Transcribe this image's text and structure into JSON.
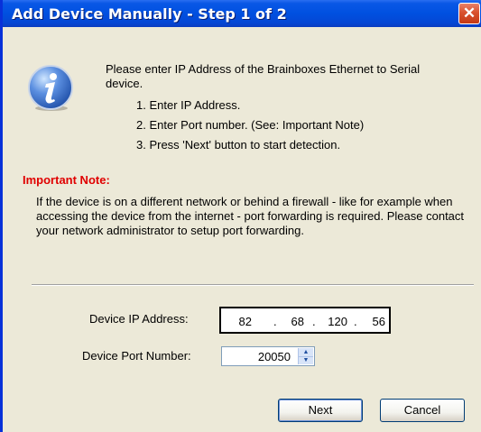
{
  "window": {
    "title": "Add Device Manually - Step 1 of 2",
    "close_glyph": "✕"
  },
  "intro": {
    "text": "Please enter IP Address of the Brainboxes Ethernet to Serial device.",
    "steps": [
      "1. Enter IP Address.",
      "2. Enter Port number. (See: Important Note)",
      "3. Press 'Next' button to start detection."
    ]
  },
  "note": {
    "title": "Important Note:",
    "text": "If the device is on a different network or behind a firewall - like for example when accessing the device from the internet - port forwarding is required. Please contact your network administrator to setup port forwarding."
  },
  "form": {
    "ip_label": "Device IP Address:",
    "ip_segments": [
      "82",
      "68",
      "120",
      "56"
    ],
    "ip_separator": ".",
    "port_label": "Device Port Number:",
    "port_value": "20050"
  },
  "buttons": {
    "next": "Next",
    "cancel": "Cancel"
  },
  "icons": {
    "info": "info-icon",
    "close": "close-icon",
    "spin_up": "spin-up-icon",
    "spin_down": "spin-down-icon"
  },
  "colors": {
    "title_bar": "#0050e0",
    "dialog_bg": "#ece9d8",
    "note_title": "#e00000",
    "close_button": "#d9512e"
  }
}
